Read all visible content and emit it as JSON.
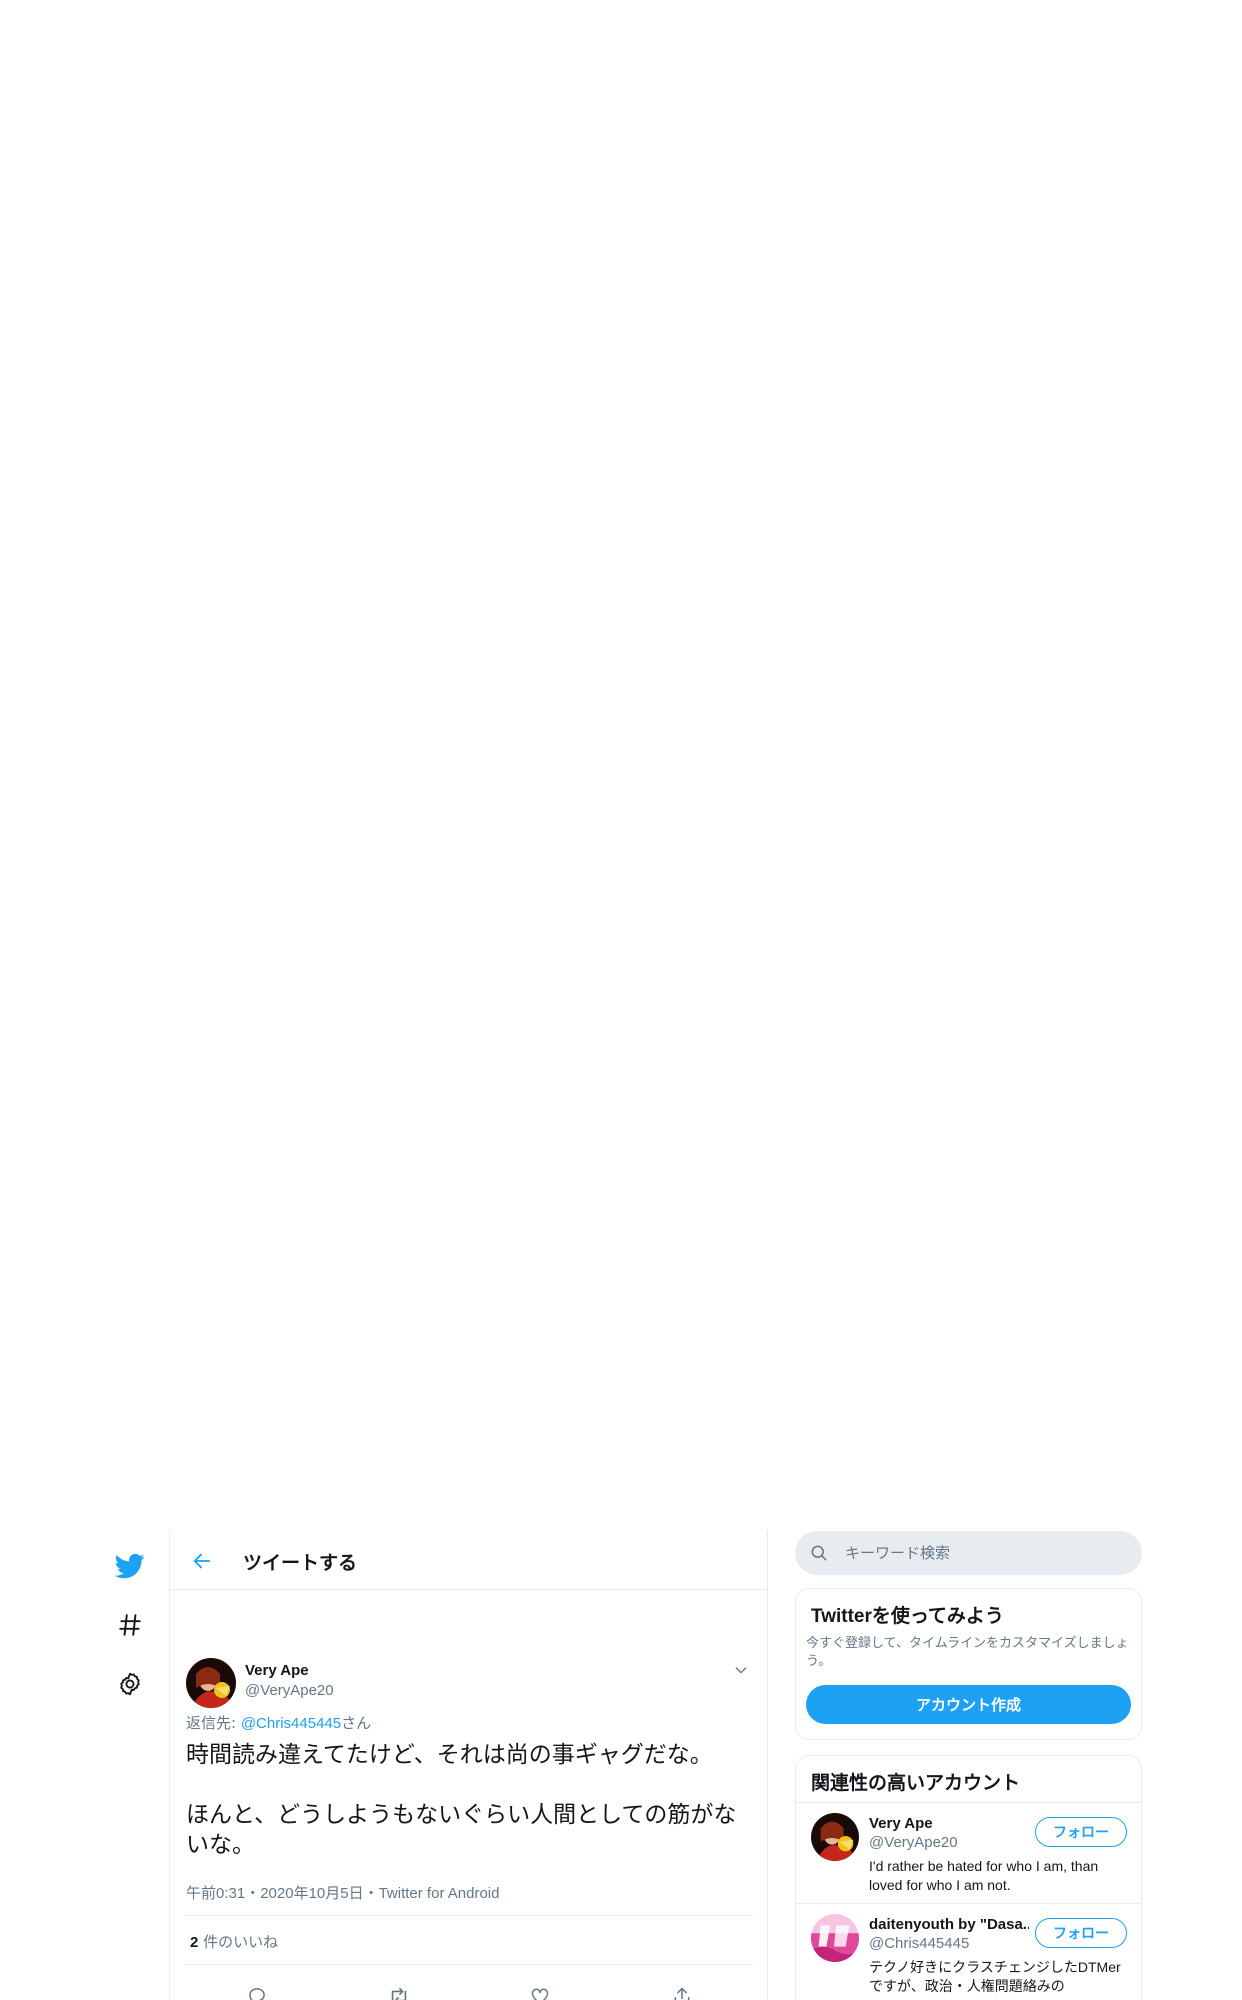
{
  "header": {
    "title": "ツイートする"
  },
  "tweet": {
    "user_name": "Very Ape",
    "user_handle": "@VeryApe20",
    "reply_prefix": "返信先: ",
    "reply_mention": "@Chris445445",
    "reply_suffix": "さん",
    "text": "時間読み違えてたけど、それは尚の事ギャグだな。\n\nほんと、どうしようもないぐらい人間としての筋がないな。",
    "meta": "午前0:31・2020年10月5日・Twitter for Android",
    "likes_count": "2",
    "likes_label": " 件のいいね"
  },
  "search": {
    "placeholder": "キーワード検索"
  },
  "signup_card": {
    "title": "Twitterを使ってみよう",
    "description": "今すぐ登録して、タイムラインをカスタマイズしましょう。",
    "button_label": "アカウント作成"
  },
  "related": {
    "title": "関連性の高いアカウント",
    "accounts": [
      {
        "name": "Very Ape",
        "handle": "@VeryApe20",
        "bio": "I'd rather be hated for who I am, than loved for who I am not.",
        "follow_label": "フォロー"
      },
      {
        "name": "daitenyouth by \"Dasa...",
        "handle": "@Chris445445",
        "bio": "テクノ好きにクラスチェンジしたDTMerですが、政治・人権問題絡みの",
        "follow_label": "フォロー"
      }
    ]
  },
  "colors": {
    "accent": "#1da1f2",
    "text": "#14171a",
    "secondary": "#657786",
    "border": "#e6ecf0"
  },
  "icons": {
    "logo": "twitter-bird-icon",
    "explore": "hashtag-icon",
    "settings": "gear-icon",
    "back": "arrow-left-icon",
    "caret": "chevron-down-icon",
    "search": "search-icon",
    "reply": "reply-icon",
    "retweet": "retweet-icon",
    "like": "heart-icon",
    "share": "share-icon"
  }
}
